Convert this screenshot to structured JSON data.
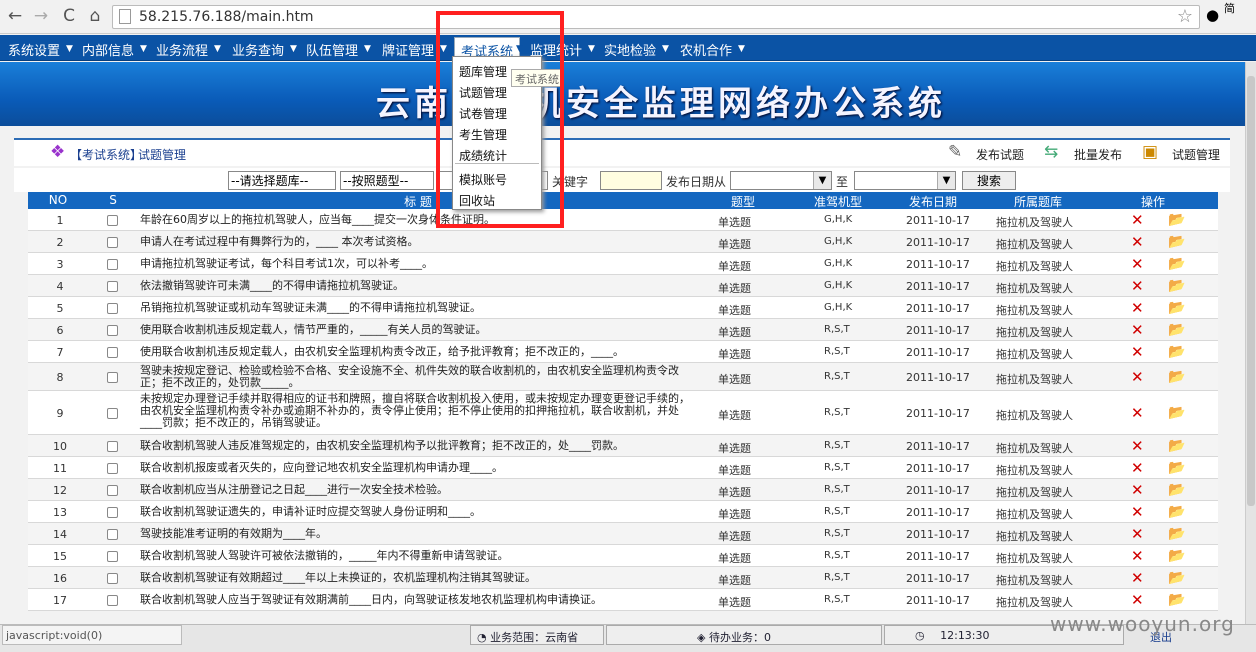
{
  "browser": {
    "url": "58.215.76.188/main.htm",
    "user_initial": "简"
  },
  "menu": {
    "items": [
      "系统设置",
      "内部信息",
      "业务流程",
      "业务查询",
      "队伍管理",
      "牌证管理",
      "考试系统",
      "监理统计",
      "实地检验",
      "农机合作"
    ],
    "selected_index": 6
  },
  "dropdown": {
    "items": [
      "题库管理",
      "试题管理",
      "试卷管理",
      "考生管理",
      "成绩统计",
      "模拟账号",
      "回收站"
    ],
    "tooltip": "考试系统"
  },
  "banner": {
    "title": "云南省农机安全监理网络办公系统"
  },
  "breadcrumb": {
    "prefix": "【考试系统】",
    "page": "试题管理",
    "actions": [
      "发布试题",
      "批量发布",
      "试题管理"
    ]
  },
  "filter": {
    "bank": "--请选择题库--",
    "type": "--按照题型--",
    "keyword_label": "关键字",
    "date_label": "发布日期从",
    "to_label": "至",
    "search": "搜索"
  },
  "table": {
    "headers": [
      "NO",
      "S",
      "标   题",
      "题型",
      "准驾机型",
      "发布日期",
      "所属题库",
      "操作"
    ],
    "rows": [
      {
        "no": "1",
        "title": "年龄在60周岁以上的拖拉机驾驶人，应当每____提交一次身体条件证明。",
        "type": "单选题",
        "model": "G,H,K",
        "date": "2011-10-17",
        "bank": "拖拉机及驾驶人"
      },
      {
        "no": "2",
        "title": "申请人在考试过程中有舞弊行为的，____ 本次考试资格。",
        "type": "单选题",
        "model": "G,H,K",
        "date": "2011-10-17",
        "bank": "拖拉机及驾驶人"
      },
      {
        "no": "3",
        "title": "申请拖拉机驾驶证考试，每个科目考试1次，可以补考____。",
        "type": "单选题",
        "model": "G,H,K",
        "date": "2011-10-17",
        "bank": "拖拉机及驾驶人"
      },
      {
        "no": "4",
        "title": "依法撤销驾驶许可未满____的不得申请拖拉机驾驶证。",
        "type": "单选题",
        "model": "G,H,K",
        "date": "2011-10-17",
        "bank": "拖拉机及驾驶人"
      },
      {
        "no": "5",
        "title": "吊销拖拉机驾驶证或机动车驾驶证未满____的不得申请拖拉机驾驶证。",
        "type": "单选题",
        "model": "G,H,K",
        "date": "2011-10-17",
        "bank": "拖拉机及驾驶人"
      },
      {
        "no": "6",
        "title": "使用联合收割机违反规定载人，情节严重的，_____有关人员的驾驶证。",
        "type": "单选题",
        "model": "R,S,T",
        "date": "2011-10-17",
        "bank": "拖拉机及驾驶人"
      },
      {
        "no": "7",
        "title": "使用联合收割机违反规定载人，由农机安全监理机构责令改正，给予批评教育；拒不改正的，____。",
        "type": "单选题",
        "model": "R,S,T",
        "date": "2011-10-17",
        "bank": "拖拉机及驾驶人"
      },
      {
        "no": "8",
        "title": "驾驶未按规定登记、检验或检验不合格、安全设施不全、机件失效的联合收割机的，由农机安全监理机构责令改正；拒不改正的，处罚款_____。",
        "type": "单选题",
        "model": "R,S,T",
        "date": "2011-10-17",
        "bank": "拖拉机及驾驶人"
      },
      {
        "no": "9",
        "title": "未按规定办理登记手续并取得相应的证书和牌照，擅自将联合收割机投入使用，或未按规定办理变更登记手续的，由农机安全监理机构责令补办或逾期不补办的，责令停止使用；拒不停止使用的扣押拖拉机，联合收割机，并处____罚款；拒不改正的，吊销驾驶证。",
        "type": "单选题",
        "model": "R,S,T",
        "date": "2011-10-17",
        "bank": "拖拉机及驾驶人"
      },
      {
        "no": "10",
        "title": "联合收割机驾驶人违反准驾规定的，由农机安全监理机构予以批评教育；拒不改正的，处____罚款。",
        "type": "单选题",
        "model": "R,S,T",
        "date": "2011-10-17",
        "bank": "拖拉机及驾驶人"
      },
      {
        "no": "11",
        "title": "联合收割机报废或者灭失的，应向登记地农机安全监理机构申请办理____。",
        "type": "单选题",
        "model": "R,S,T",
        "date": "2011-10-17",
        "bank": "拖拉机及驾驶人"
      },
      {
        "no": "12",
        "title": "联合收割机应当从注册登记之日起____进行一次安全技术检验。",
        "type": "单选题",
        "model": "R,S,T",
        "date": "2011-10-17",
        "bank": "拖拉机及驾驶人"
      },
      {
        "no": "13",
        "title": "联合收割机驾驶证遗失的，申请补证时应提交驾驶人身份证明和____。",
        "type": "单选题",
        "model": "R,S,T",
        "date": "2011-10-17",
        "bank": "拖拉机及驾驶人"
      },
      {
        "no": "14",
        "title": "驾驶技能准考证明的有效期为____年。",
        "type": "单选题",
        "model": "R,S,T",
        "date": "2011-10-17",
        "bank": "拖拉机及驾驶人"
      },
      {
        "no": "15",
        "title": "联合收割机驾驶人驾驶许可被依法撤销的，_____年内不得重新申请驾驶证。",
        "type": "单选题",
        "model": "R,S,T",
        "date": "2011-10-17",
        "bank": "拖拉机及驾驶人"
      },
      {
        "no": "16",
        "title": "联合收割机驾驶证有效期超过____年以上未换证的，农机监理机构注销其驾驶证。",
        "type": "单选题",
        "model": "R,S,T",
        "date": "2011-10-17",
        "bank": "拖拉机及驾驶人"
      },
      {
        "no": "17",
        "title": "联合收割机驾驶人应当于驾驶证有效期满前____日内，向驾驶证核发地农机监理机构申请换证。",
        "type": "单选题",
        "model": "R,S,T",
        "date": "2011-10-17",
        "bank": "拖拉机及驾驶人"
      }
    ]
  },
  "status": {
    "js": "javascript:void(0)",
    "scope": "业务范围：云南省",
    "todo": "待办业务：0",
    "time": "12:13:30",
    "logout": "退出"
  },
  "watermark": "www.wooyun.org"
}
